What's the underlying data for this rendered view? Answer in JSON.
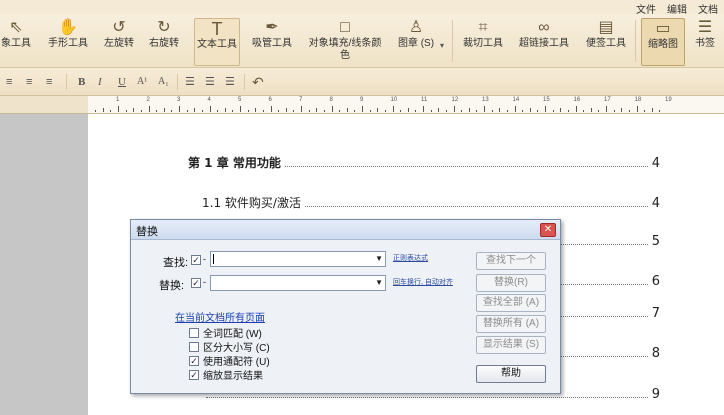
{
  "menu": {
    "items": [
      "文件",
      "编辑",
      "文档"
    ]
  },
  "ribbon": {
    "tools": [
      {
        "label": "象工具",
        "icon": "cursor-icon"
      },
      {
        "label": "手形工具",
        "icon": "hand-icon"
      },
      {
        "label": "左旋转",
        "icon": "rotate-left-icon"
      },
      {
        "label": "右旋转",
        "icon": "rotate-right-icon"
      },
      {
        "label": "文本工具",
        "icon": "text-tool-icon"
      },
      {
        "label": "吸管工具",
        "icon": "eyedropper-icon"
      },
      {
        "label": "对象填充/线条颜色",
        "icon": "fill-square-icon"
      },
      {
        "label": "图章 (S)",
        "icon": "stamp-icon"
      },
      {
        "label": "裁切工具",
        "icon": "crop-icon"
      },
      {
        "label": "超链接工具",
        "icon": "hyperlink-icon"
      },
      {
        "label": "便签工具",
        "icon": "sticky-note-icon"
      },
      {
        "label": "缩略图",
        "icon": "thumbnail-icon"
      },
      {
        "label": "书签",
        "icon": "bookmark-list-icon"
      }
    ]
  },
  "format_bar": {
    "bold": "B",
    "italic": "I",
    "underline": "U",
    "superscript": "A¹",
    "subscript": "A₁"
  },
  "ruler": {
    "numbers": [
      "1",
      "2",
      "3",
      "4",
      "5",
      "6",
      "7",
      "8",
      "9",
      "10",
      "11",
      "12",
      "13",
      "14",
      "15",
      "16",
      "17",
      "18",
      "19"
    ]
  },
  "document": {
    "toc": [
      {
        "text": "第 1 章  常用功能",
        "page": "4"
      },
      {
        "text": "1.1 软件购买/激活",
        "page": "4"
      },
      {
        "text": "",
        "page": "5"
      },
      {
        "text": "",
        "page": "6"
      },
      {
        "text": "",
        "page": "7"
      },
      {
        "text": "",
        "page": "8"
      },
      {
        "text": "",
        "page": "9"
      }
    ]
  },
  "dialog": {
    "title": "替换",
    "find_label": "查找:",
    "replace_label": "替换:",
    "find_value": "",
    "replace_value": "",
    "find_hint": "正则表达式",
    "replace_hint": "回车换行, 自动对齐",
    "scope_link": "在当前文档所有页面",
    "options": [
      {
        "label": "全词匹配 (W)",
        "checked": false
      },
      {
        "label": "区分大小写 (C)",
        "checked": false
      },
      {
        "label": "使用通配符 (U)",
        "checked": true
      },
      {
        "label": "缩放显示结果",
        "checked": true
      }
    ],
    "buttons": {
      "find_next": "查找下一个",
      "replace": "替换(R)",
      "find_all": "查找全部 (A)",
      "replace_all": "替换所有 (A)",
      "show_results": "显示结果 (S)",
      "help": "帮助"
    }
  },
  "colors": {
    "ribbon": "#f2e6cc",
    "dialog_bg": "#eef1f6",
    "link": "#1b3fb3"
  }
}
